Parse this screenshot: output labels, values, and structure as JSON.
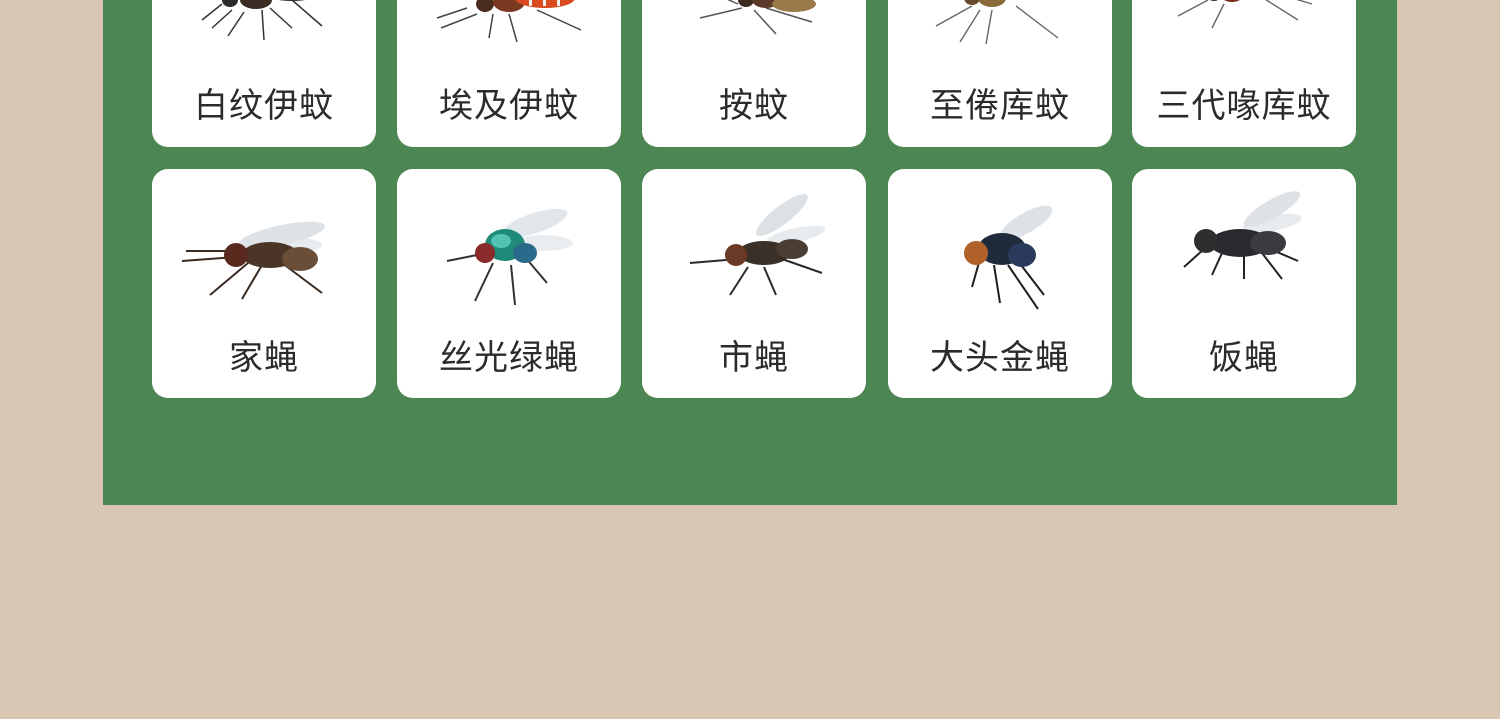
{
  "rows": [
    {
      "cards": [
        {
          "label": "白纹伊蚊",
          "icon": "mosquito-striped-icon"
        },
        {
          "label": "埃及伊蚊",
          "icon": "mosquito-red-icon"
        },
        {
          "label": "按蚊",
          "icon": "mosquito-anopheles-icon"
        },
        {
          "label": "至倦库蚊",
          "icon": "mosquito-culex-icon"
        },
        {
          "label": "三代喙库蚊",
          "icon": "mosquito-tritaeniorhynchus-icon"
        }
      ]
    },
    {
      "cards": [
        {
          "label": "家蝇",
          "icon": "housefly-icon"
        },
        {
          "label": "丝光绿蝇",
          "icon": "green-bottle-fly-icon"
        },
        {
          "label": "市蝇",
          "icon": "market-fly-icon"
        },
        {
          "label": "大头金蝇",
          "icon": "blowfly-icon"
        },
        {
          "label": "饭蝇",
          "icon": "black-fly-icon"
        }
      ]
    }
  ],
  "colors": {
    "background": "#d9c7b3",
    "panel": "#4c8652",
    "card": "#ffffff",
    "text": "#2b2b2b"
  }
}
